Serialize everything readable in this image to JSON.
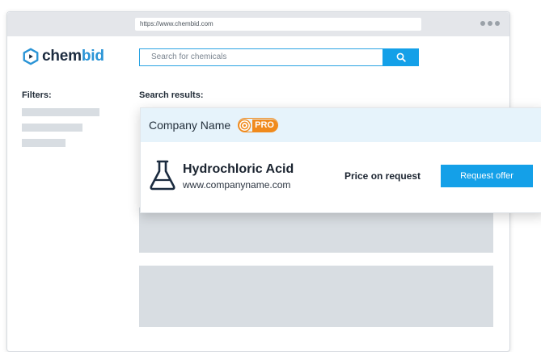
{
  "browser": {
    "url": "https://www.chembid.com",
    "window_dots": [
      "dot",
      "dot",
      "dot"
    ]
  },
  "logo": {
    "icon": "chembid-logo-icon",
    "text_part1": "chem",
    "text_part2": "bid",
    "colors": {
      "dark": "#1b2b3f",
      "accent": "#2a94d6"
    }
  },
  "search": {
    "placeholder": "Search for chemicals",
    "button_icon": "search-icon",
    "color": "#14a0e8"
  },
  "filters": {
    "label": "Filters:"
  },
  "results": {
    "label": "Search results:",
    "card": {
      "company_name": "Company Name",
      "badge": {
        "icon": "pro-badge-icon",
        "text": "PRO",
        "color": "#f08a1c"
      },
      "product_icon": "flask-icon",
      "product_name": "Hydrochloric Acid",
      "product_url": "www.companyname.com",
      "price_text": "Price on request",
      "offer_button_label": "Request offer"
    }
  }
}
